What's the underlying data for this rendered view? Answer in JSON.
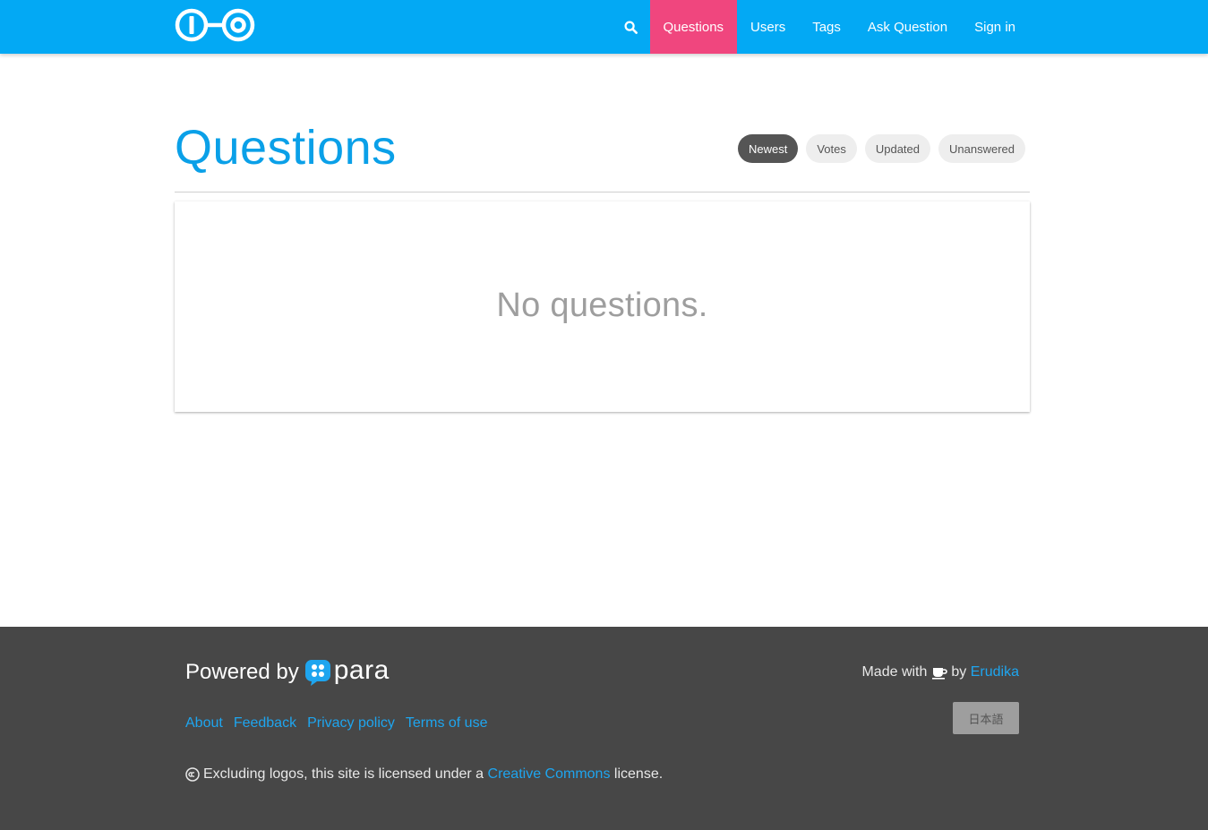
{
  "header": {
    "nav": {
      "questions": "Questions",
      "users": "Users",
      "tags": "Tags",
      "ask": "Ask Question",
      "signin": "Sign in"
    },
    "brand_color": "#03a9f4",
    "active_color": "#f0467e"
  },
  "main": {
    "title": "Questions",
    "sort": [
      "Newest",
      "Votes",
      "Updated",
      "Unanswered"
    ],
    "sort_selected": "Newest",
    "empty_message": "No questions."
  },
  "footer": {
    "powered_by": "Powered by",
    "para_word": "para",
    "made_with": "Made with",
    "by": "by",
    "author": "Erudika",
    "language_button": "日本語",
    "links": [
      "About",
      "Feedback",
      "Privacy policy",
      "Terms of use"
    ],
    "license_prefix": "Excluding logos, this site is licensed under a",
    "license_link": "Creative Commons",
    "license_suffix": "license.",
    "background": "#474747",
    "link_color": "#1ea5ef"
  }
}
